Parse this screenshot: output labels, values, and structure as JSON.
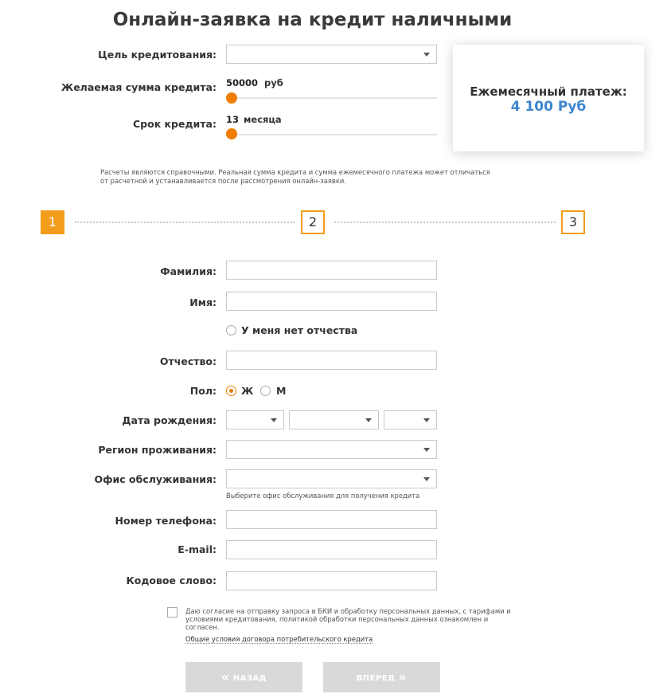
{
  "title": "Онлайн-заявка на кредит наличными",
  "calculator": {
    "purpose_label": "Цель кредитования:",
    "purpose_value": "",
    "amount_label": "Желаемая сумма кредита:",
    "amount_value": "50000",
    "amount_unit": "руб",
    "amount_slider_fraction": 0,
    "term_label": "Срок кредита:",
    "term_value": "13",
    "term_unit": "месяца",
    "term_slider_fraction": 0
  },
  "payment": {
    "label": "Ежемесячный платеж:",
    "value": "4 100 Руб"
  },
  "note": "Расчеты являются справочными. Реальная сумма кредита и сумма ежемесячного платежа может отличаться от расчетной и устанавливается после рассмотрения онлайн-заявки.",
  "steps": [
    {
      "label": "1",
      "active": true
    },
    {
      "label": "2",
      "active": false
    },
    {
      "label": "3",
      "active": false
    }
  ],
  "form": {
    "surname_label": "Фамилия:",
    "surname_value": "",
    "name_label": "Имя:",
    "name_value": "",
    "no_patronymic_label": "У меня нет отчества",
    "patronymic_label": "Отчество:",
    "patronymic_value": "",
    "gender_label": "Пол:",
    "gender_female": "Ж",
    "gender_male": "М",
    "gender_selected": "Ж",
    "birthdate_label": "Дата рождения:",
    "region_label": "Регион проживания:",
    "office_label": "Офис обслуживания:",
    "office_hint": "Выберите офис обслуживания для получения кредита",
    "phone_label": "Номер телефона:",
    "phone_value": "",
    "email_label": "E-mail:",
    "email_value": "",
    "codeword_label": "Кодовое слово:",
    "codeword_value": ""
  },
  "consent": {
    "text": "Даю согласие на отправку запроса в БКИ и обработку персональных данных, с тарифами и условиями кредитования, политикой обработки персональных данных ознакомлен и согласен.",
    "terms_link": "Общие условия договора потребительского кредита"
  },
  "buttons": {
    "back": "НАЗАД",
    "next": "ВПЕРЕД"
  },
  "colors": {
    "accent": "#f07d00",
    "step_active": "#f49c1b",
    "payment_value": "#3c86cf",
    "button_disabled": "#d9d9d9"
  }
}
